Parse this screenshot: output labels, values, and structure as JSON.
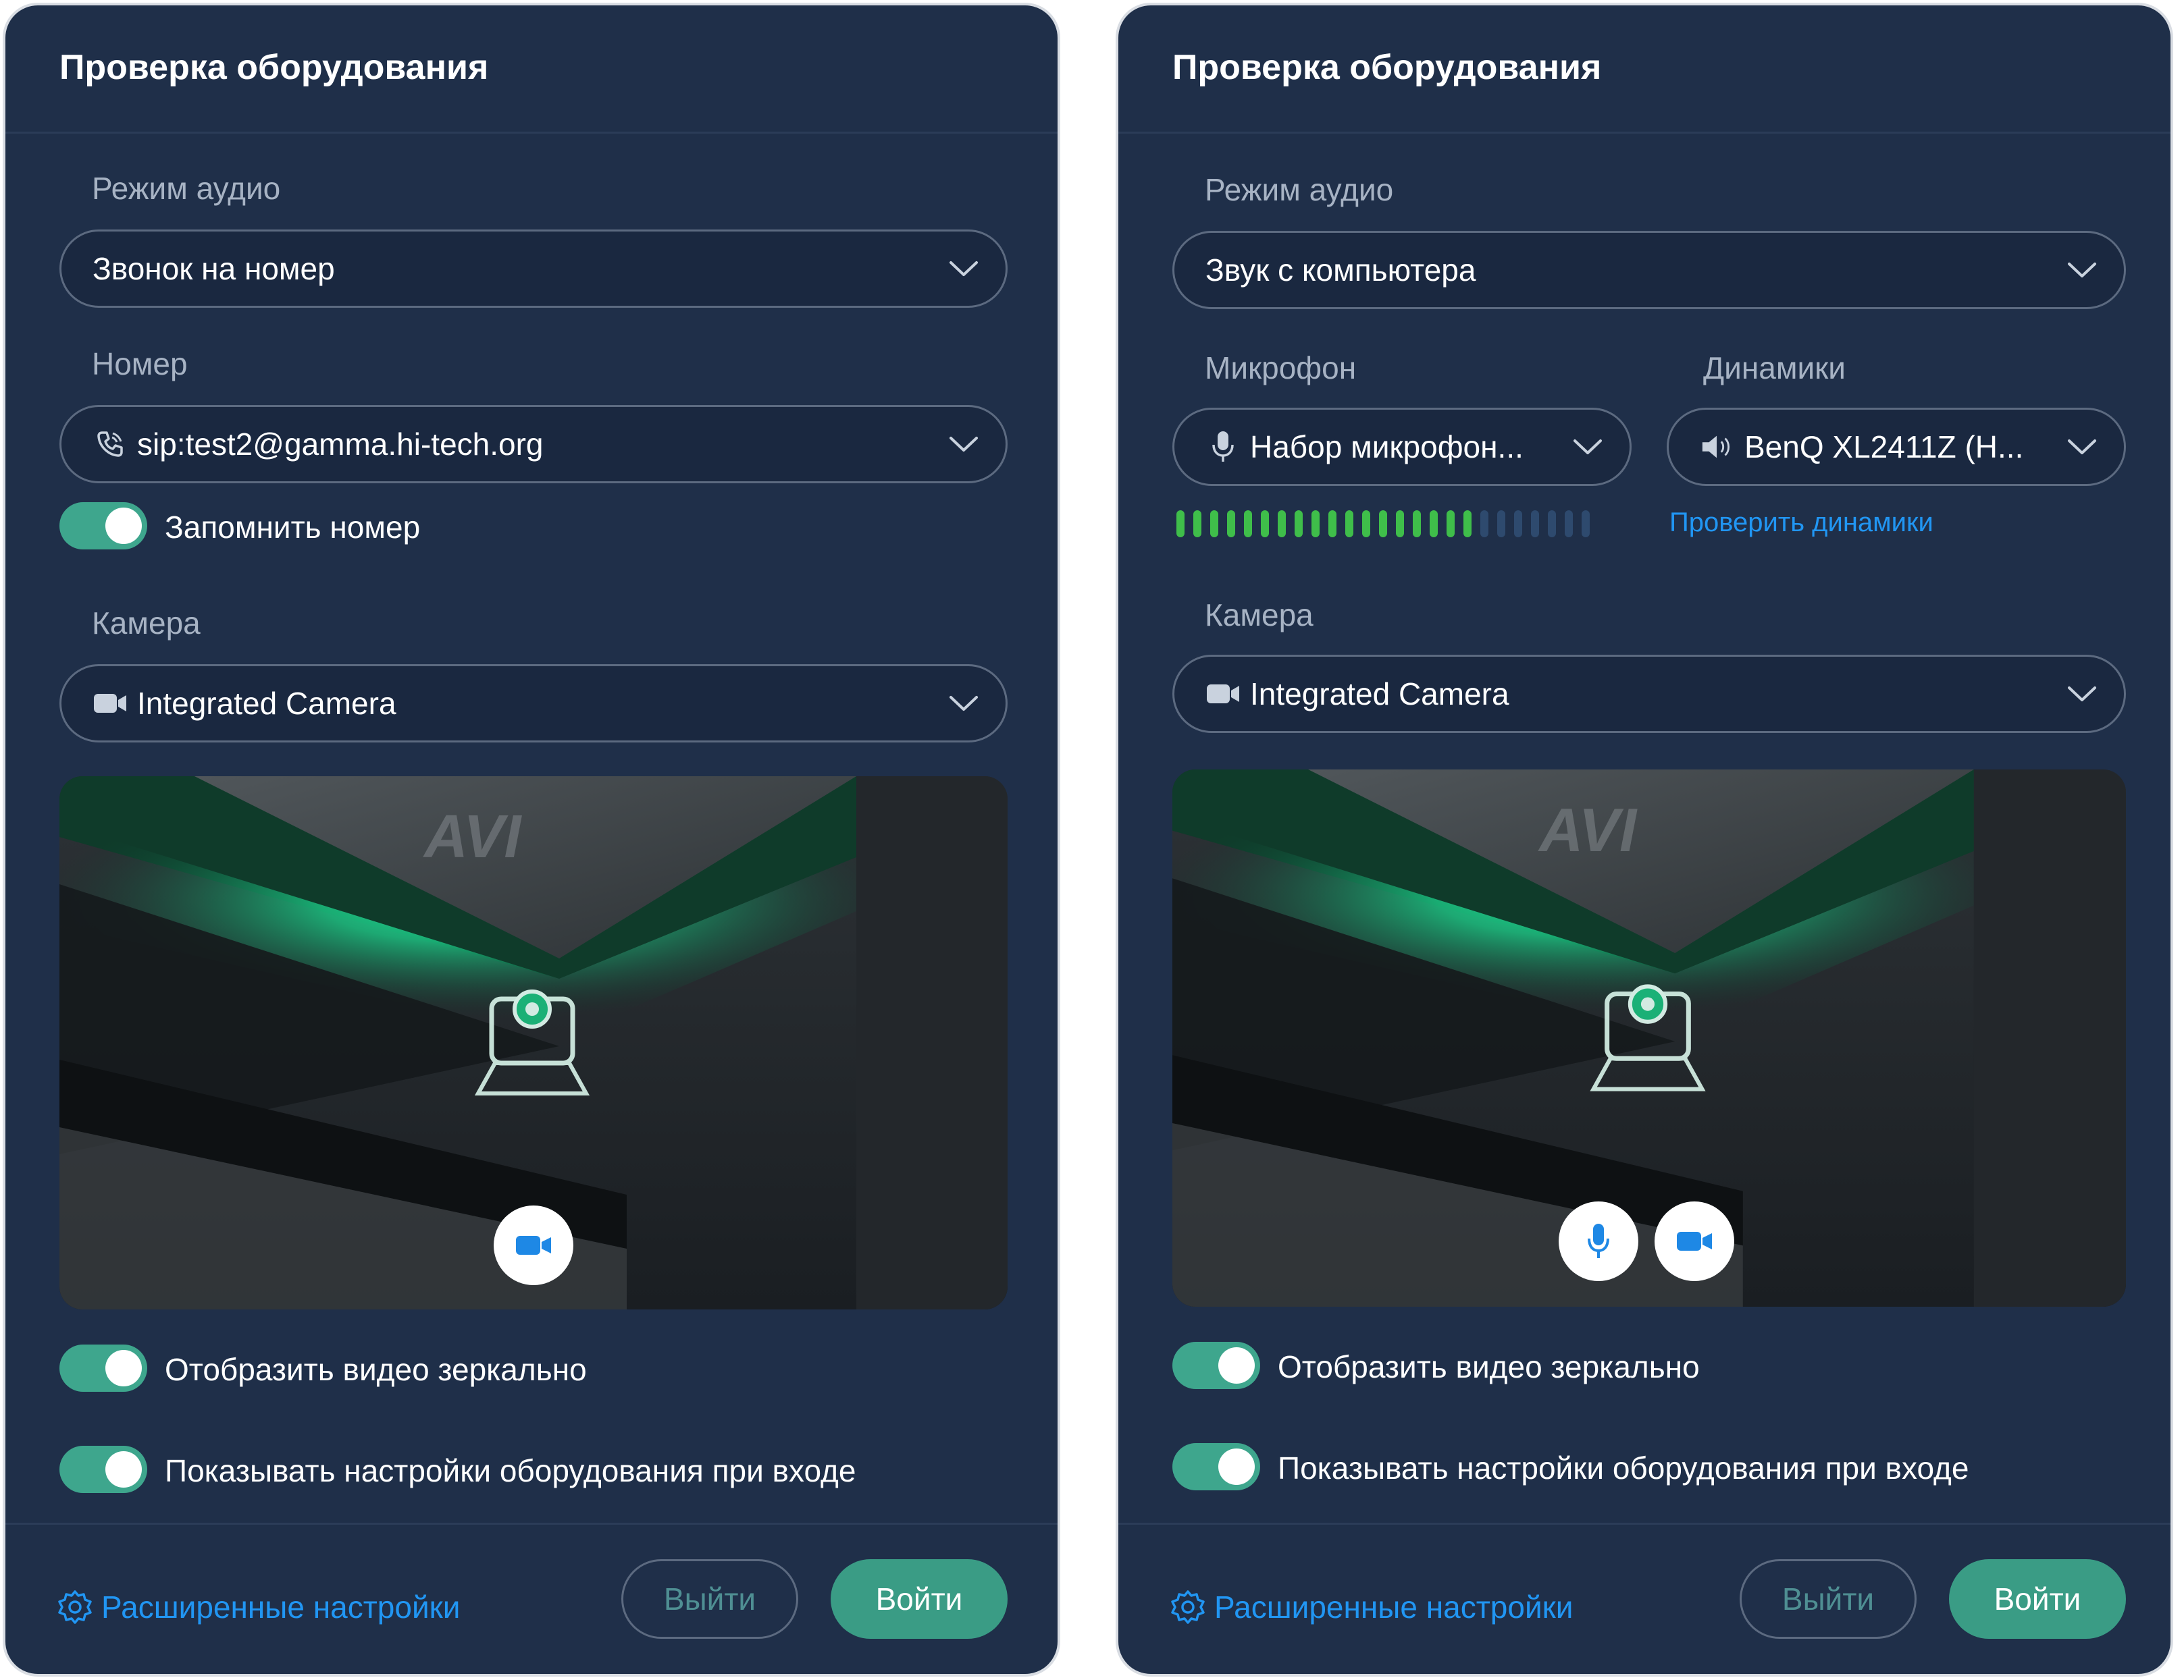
{
  "colors": {
    "panel_bg": "#1f2f49",
    "accent_green": "#3a9c85",
    "link_blue": "#2196f3",
    "meter_active": "#3fbe4a",
    "meter_inactive": "#2e4a6e"
  },
  "left": {
    "title": "Проверка оборудования",
    "audio_mode_label": "Режим аудио",
    "audio_mode_value": "Звонок на номер",
    "number_label": "Номер",
    "number_value": "sip:test2@gamma.hi-tech.org",
    "remember_label": "Запомнить номер",
    "camera_label": "Камера",
    "camera_value": "Integrated Camera",
    "mirror_label": "Отобразить видео зеркально",
    "show_settings_label": "Показывать настройки оборудования при входе",
    "advanced_label": "Расширенные настройки",
    "exit_label": "Выйти",
    "enter_label": "Войти"
  },
  "right": {
    "title": "Проверка оборудования",
    "audio_mode_label": "Режим аудио",
    "audio_mode_value": "Звук с компьютера",
    "mic_label": "Микрофон",
    "mic_value": "Набор микрофон...",
    "speakers_label": "Динамики",
    "speakers_value": "BenQ XL2411Z (H...",
    "check_speakers_link": "Проверить динамики",
    "mic_level": {
      "active": 18,
      "total": 25
    },
    "camera_label": "Камера",
    "camera_value": "Integrated Camera",
    "mirror_label": "Отобразить видео зеркально",
    "show_settings_label": "Показывать настройки оборудования при входе",
    "advanced_label": "Расширенные настройки",
    "exit_label": "Выйти",
    "enter_label": "Войти"
  },
  "icons": [
    "chevron-down-icon",
    "phone-icon",
    "camera-icon",
    "microphone-icon",
    "speaker-icon",
    "gear-icon"
  ]
}
